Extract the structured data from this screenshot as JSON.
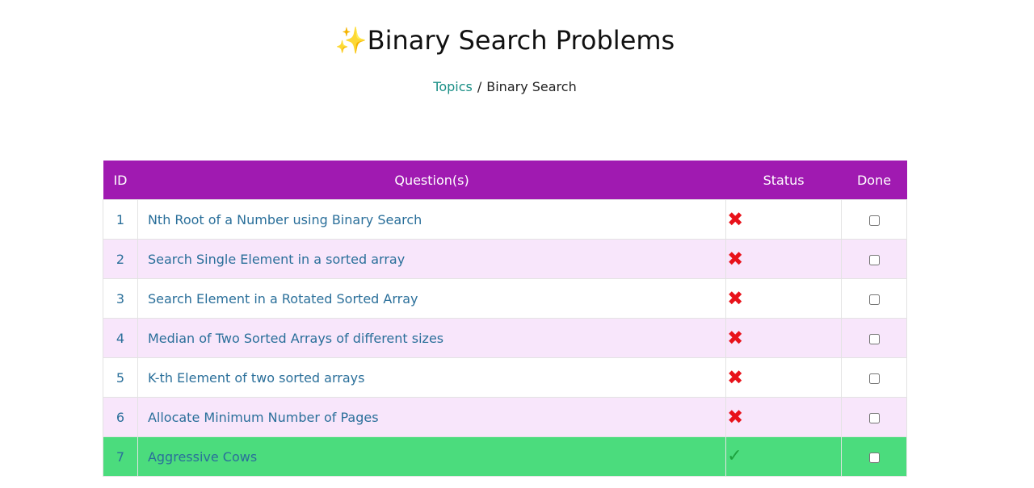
{
  "header": {
    "sparkle_icon": "✨",
    "title": "Binary Search Problems"
  },
  "breadcrumb": {
    "parent": "Topics",
    "separator": "/",
    "current": "Binary Search"
  },
  "table": {
    "headers": {
      "id": "ID",
      "question": "Question(s)",
      "status": "Status",
      "done": "Done"
    },
    "rows": [
      {
        "id": "1",
        "question": "Nth Root of a Number using Binary Search",
        "status": "not-done",
        "status_glyph": "✖",
        "done": false
      },
      {
        "id": "2",
        "question": "Search Single Element in a sorted array",
        "status": "not-done",
        "status_glyph": "✖",
        "done": false
      },
      {
        "id": "3",
        "question": "Search Element in a Rotated Sorted Array",
        "status": "not-done",
        "status_glyph": "✖",
        "done": false
      },
      {
        "id": "4",
        "question": "Median of Two Sorted Arrays of different sizes",
        "status": "not-done",
        "status_glyph": "✖",
        "done": false
      },
      {
        "id": "5",
        "question": "K-th Element of two sorted arrays",
        "status": "not-done",
        "status_glyph": "✖",
        "done": false
      },
      {
        "id": "6",
        "question": "Allocate Minimum Number of Pages",
        "status": "not-done",
        "status_glyph": "✖",
        "done": false
      },
      {
        "id": "7",
        "question": "Aggressive Cows",
        "status": "done",
        "status_glyph": "✓",
        "done": false
      }
    ]
  },
  "colors": {
    "header_bg": "#a01ab1",
    "row_alt_bg": "#f8e6fb",
    "solved_row_bg": "#4bdc7d",
    "link": "#2a6f9a",
    "breadcrumb_link": "#1a8f86",
    "x_mark": "#e8121a",
    "check_mark": "#1ea33f"
  }
}
